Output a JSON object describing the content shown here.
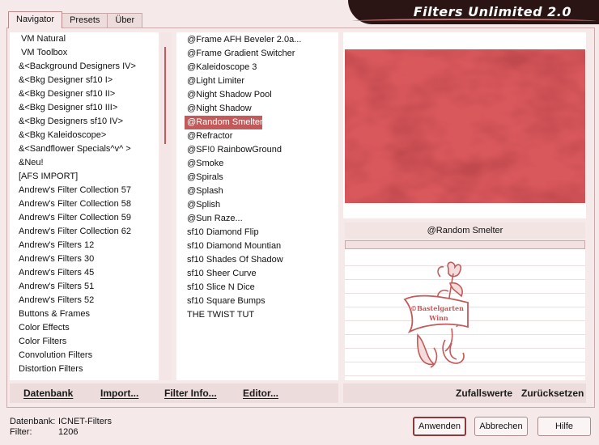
{
  "app": {
    "title": "Filters Unlimited 2.0"
  },
  "tabs": [
    {
      "label": "Navigator",
      "active": true
    },
    {
      "label": "Presets",
      "active": false
    },
    {
      "label": "Über",
      "active": false
    }
  ],
  "categories": [
    "VM Natural",
    "VM Toolbox",
    "&<Background Designers IV>",
    "&<Bkg Designer sf10 I>",
    "&<Bkg Designer sf10 II>",
    "&<Bkg Designer sf10 III>",
    "&<Bkg Designers sf10 IV>",
    "&<Bkg Kaleidoscope>",
    "&<Sandflower Specials^v^ >",
    "&Neu!",
    "[AFS IMPORT]",
    "Andrew's Filter Collection 57",
    "Andrew's Filter Collection 58",
    "Andrew's Filter Collection 59",
    "Andrew's Filter Collection 62",
    "Andrew's Filters 12",
    "Andrew's Filters 30",
    "Andrew's Filters 45",
    "Andrew's Filters 51",
    "Andrew's Filters 52",
    "Buttons & Frames",
    "Color Effects",
    "Color Filters",
    "Convolution Filters",
    "Distortion Filters"
  ],
  "filters": [
    "@Frame AFH Beveler 2.0a...",
    "@Frame Gradient Switcher",
    "@Kaleidoscope 3",
    "@Light Limiter",
    "@Night Shadow Pool",
    "@Night Shadow",
    "@Random Smelter",
    "@Refractor",
    "@SF!0 RainbowGround",
    "@Smoke",
    "@Spirals",
    "@Splash",
    "@Splish",
    "@Sun Raze...",
    "sf10 Diamond Flip",
    "sf10 Diamond Mountian",
    "sf10 Shades Of Shadow",
    "sf10 Sheer Curve",
    "sf10 Slice N Dice",
    "sf10 Square Bumps",
    "THE TWIST TUT"
  ],
  "selected_filter_index": 6,
  "preview": {
    "filter_name": "@Random Smelter",
    "color": "#d9585c"
  },
  "logo": {
    "text_line1": "©Bastelgarten",
    "text_line2": "Winn"
  },
  "actions": {
    "database": "Datenbank",
    "import": "Import...",
    "filter_info": "Filter Info...",
    "editor": "Editor...",
    "random": "Zufallswerte",
    "reset": "Zurücksetzen"
  },
  "status": {
    "database_label": "Datenbank:",
    "database_value": "ICNET-Filters",
    "filter_label": "Filter:",
    "filter_value": "1206"
  },
  "buttons": {
    "apply": "Anwenden",
    "cancel": "Abbrechen",
    "help": "Hilfe"
  },
  "colors": {
    "accent": "#c35a5a",
    "banner": "#2a1414",
    "background": "#f6e9e9"
  }
}
